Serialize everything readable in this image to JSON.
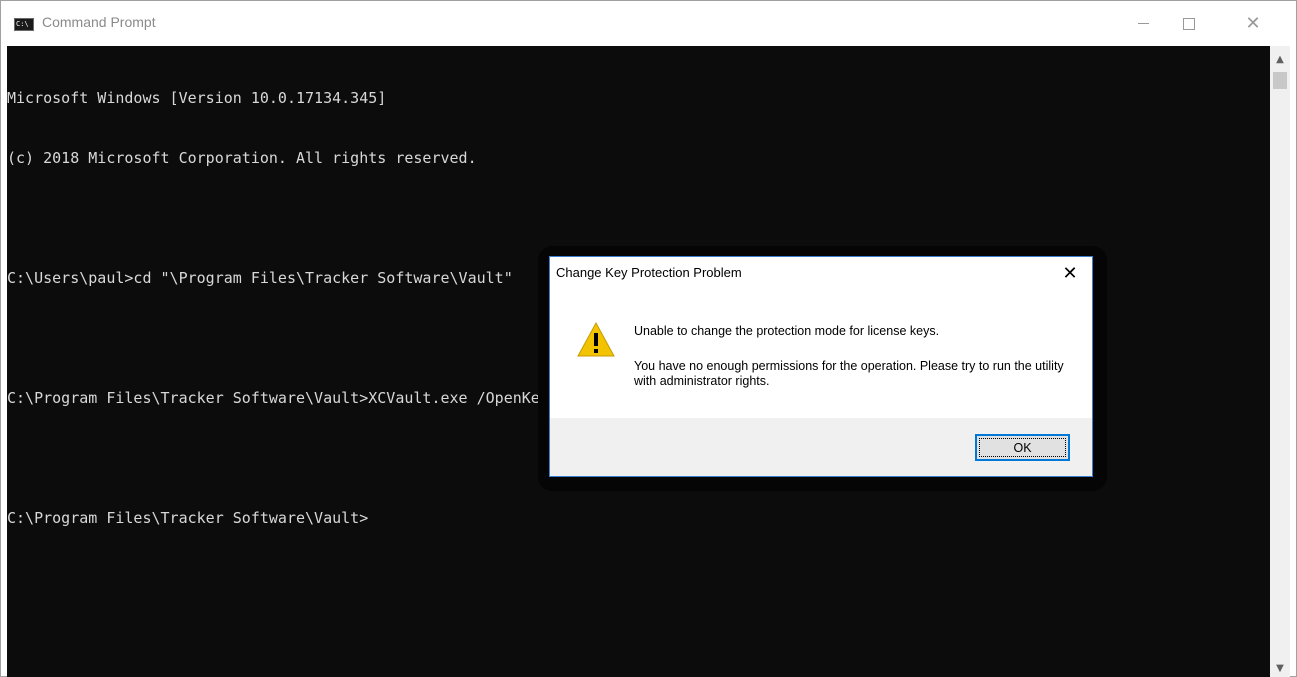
{
  "window": {
    "title": "Command Prompt",
    "icons": {
      "app": "cmd-icon",
      "minimize": "minimize-icon",
      "maximize": "maximize-icon",
      "close": "close-icon"
    }
  },
  "console": {
    "lines": [
      "Microsoft Windows [Version 10.0.17134.345]",
      "(c) 2018 Microsoft Corporation. All rights reserved.",
      "",
      "C:\\Users\\paul>cd \"\\Program Files\\Tracker Software\\Vault\"",
      "",
      "C:\\Program Files\\Tracker Software\\Vault>XCVault.exe /OpenKeys",
      "",
      "C:\\Program Files\\Tracker Software\\Vault>"
    ]
  },
  "scrollbar": {
    "up": "▲",
    "down": "▼"
  },
  "dialog": {
    "title": "Change Key Protection Problem",
    "close": "✕",
    "icon": "warning-icon",
    "message1": "Unable to change the protection mode for license keys.",
    "message2": "You have no enough permissions for the operation. Please try to run the utility with administrator rights.",
    "ok_label": "OK"
  },
  "colors": {
    "console_bg": "#0c0c0c",
    "console_fg": "#d8d8d8",
    "dialog_border": "#3b7fd1",
    "accent": "#0078d7",
    "warning": "#f2c300"
  }
}
